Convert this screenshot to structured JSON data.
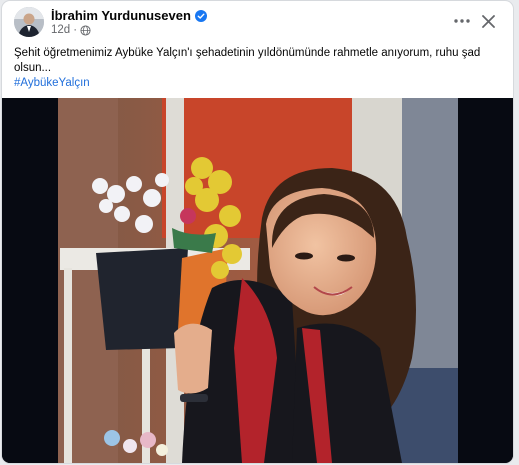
{
  "post": {
    "author_name": "İbrahim Yurdunuseven",
    "time_ago": "12d",
    "separator": "·",
    "text_line1": "Şehit öğretmenimiz Aybüke Yalçın'ı şehadetinin yıldönümünde rahmetle anıyorum, ruhu şad",
    "text_line2": "olsun...",
    "hashtag": "#AybükeYalçın"
  },
  "icons": {
    "verified": "verified-badge-icon",
    "audience": "globe-icon",
    "more": "more-options-icon",
    "close": "close-icon"
  },
  "colors": {
    "verified": "#1877f2",
    "link": "#216fdb",
    "secondary_text": "#65676b"
  }
}
